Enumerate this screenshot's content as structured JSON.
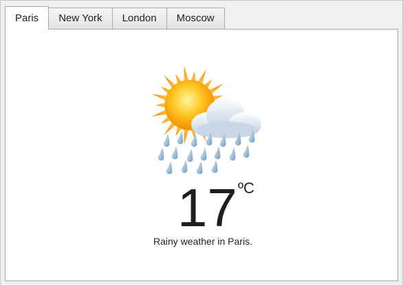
{
  "tabs": [
    {
      "label": "Paris",
      "active": true
    },
    {
      "label": "New York",
      "active": false
    },
    {
      "label": "London",
      "active": false
    },
    {
      "label": "Moscow",
      "active": false
    }
  ],
  "weather": {
    "icon": "sun-cloud-rain-icon",
    "temperature": "17",
    "unit": "ºC",
    "description": "Rainy weather in Paris."
  }
}
